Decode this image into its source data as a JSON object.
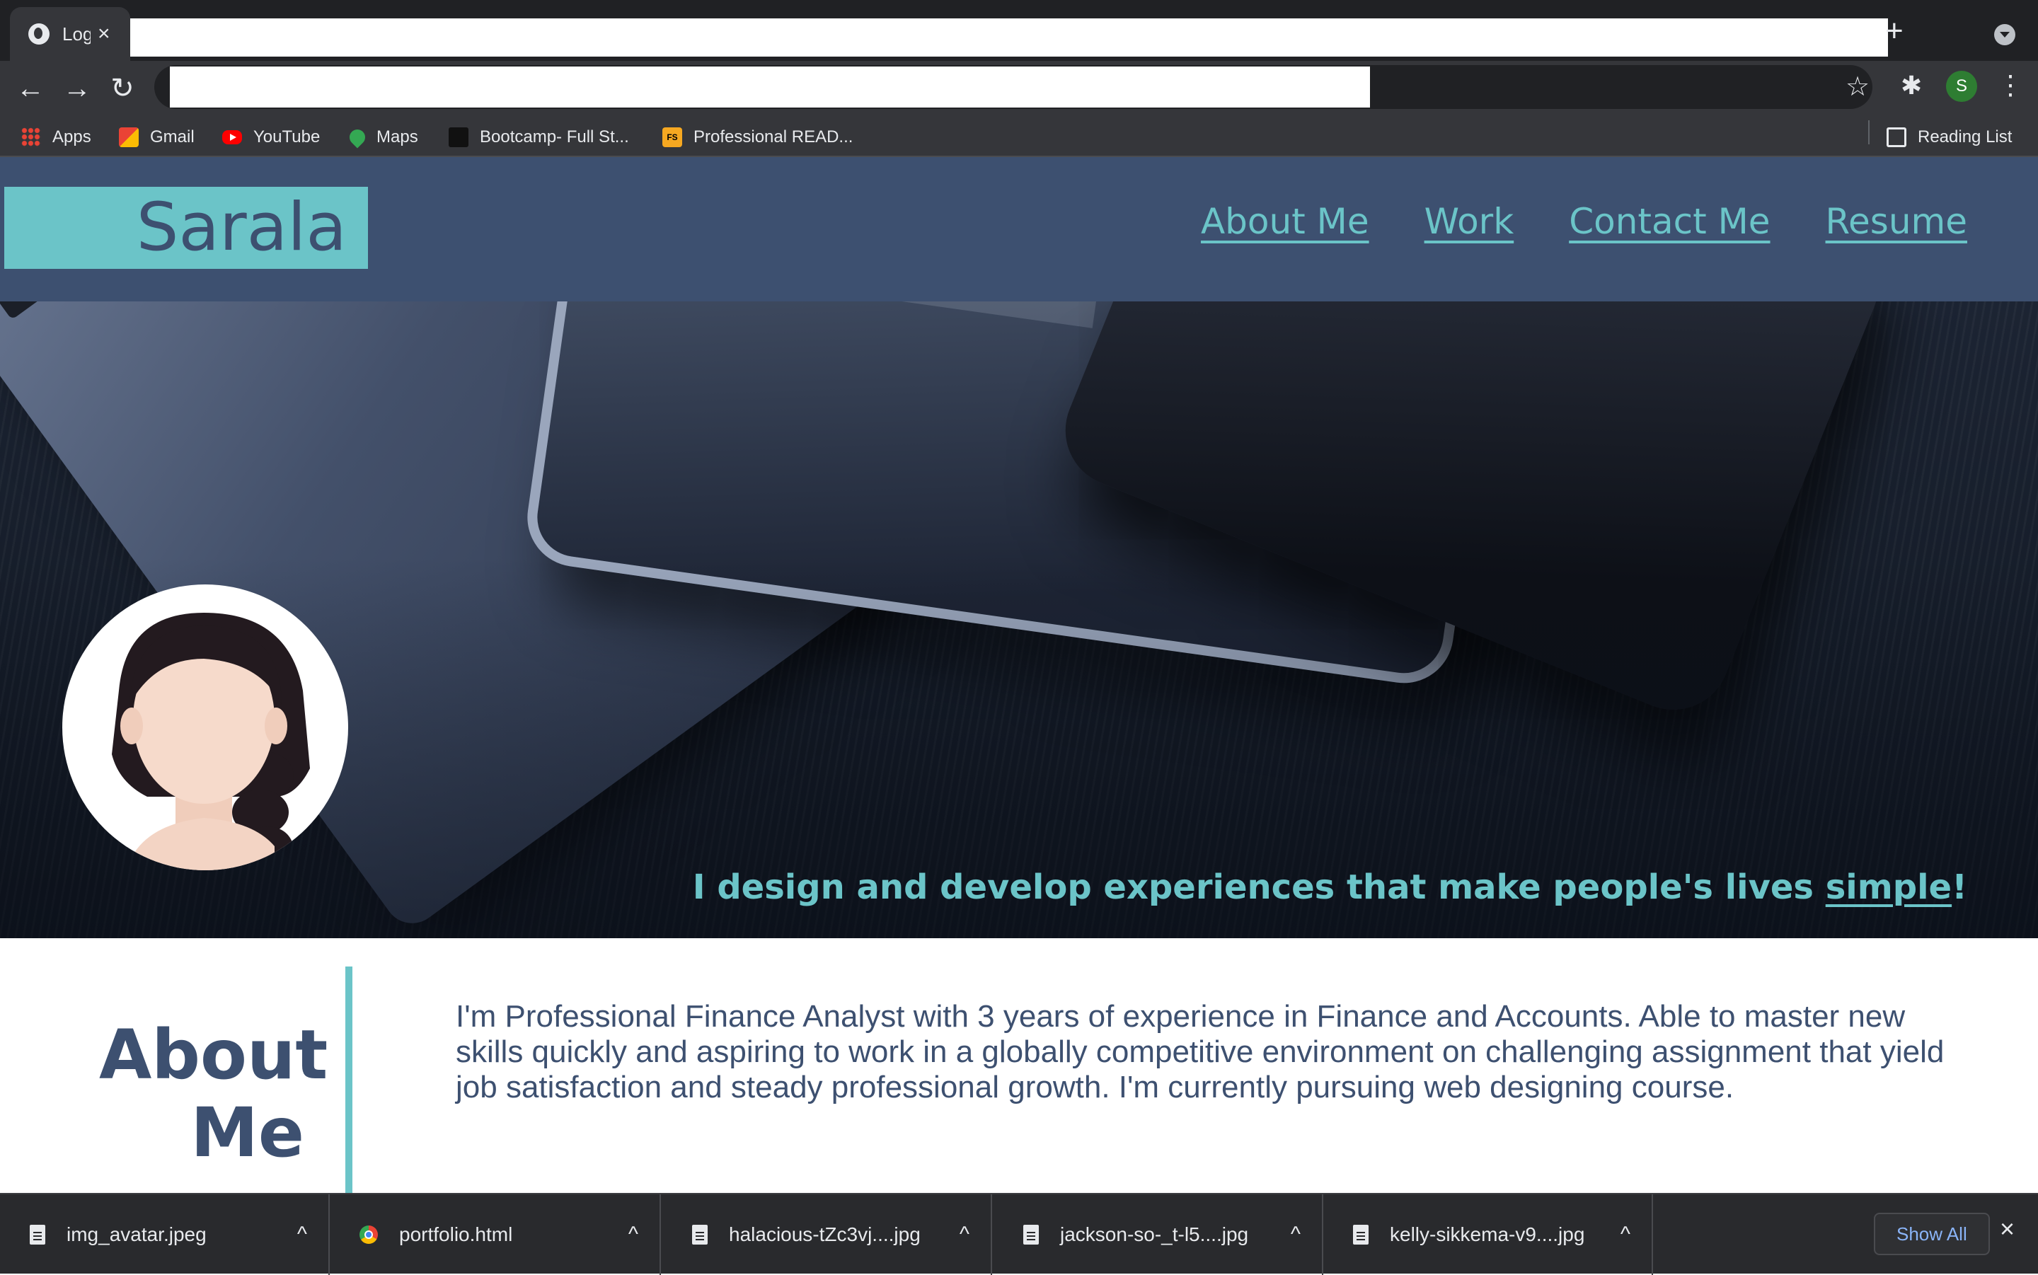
{
  "browser": {
    "tab_title": "Logi",
    "tab_close": "×",
    "new_tab": "+",
    "back": "←",
    "forward": "→",
    "reload": "↻",
    "star": "☆",
    "profile_initial": "S",
    "menu": "⋮",
    "bookmarks": {
      "apps": "Apps",
      "gmail": "Gmail",
      "youtube": "YouTube",
      "maps": "Maps",
      "bootcamp": "Bootcamp- Full St...",
      "readme": "Professional READ...",
      "reading_list": "Reading List"
    }
  },
  "page": {
    "logo": "Sarala",
    "nav": [
      "About Me",
      "Work",
      "Contact Me",
      "Resume"
    ],
    "tagline_prefix": "I design and develop experiences that make people's lives ",
    "tagline_link": "simple",
    "tagline_suffix": "!",
    "about_title_line1": "About",
    "about_title_line2": "Me",
    "about_text": "I'm Professional Finance Analyst with 3 years of experience in Finance and Accounts. Able to master new skills quickly and aspiring to work in a globally competitive environment on challenging assignment that yield job satisfaction and steady professional growth. I'm currently pursuing web designing course."
  },
  "downloads": {
    "items": [
      "img_avatar.jpeg",
      "portfolio.html",
      "halacious-tZc3vj....jpg",
      "jackson-so-_t-l5....jpg",
      "kelly-sikkema-v9....jpg"
    ],
    "caret": "^",
    "show_all": "Show All",
    "close": "×"
  },
  "colors": {
    "header_bg": "#3d5070",
    "accent": "#6bc4c8",
    "text": "#3d5070"
  }
}
